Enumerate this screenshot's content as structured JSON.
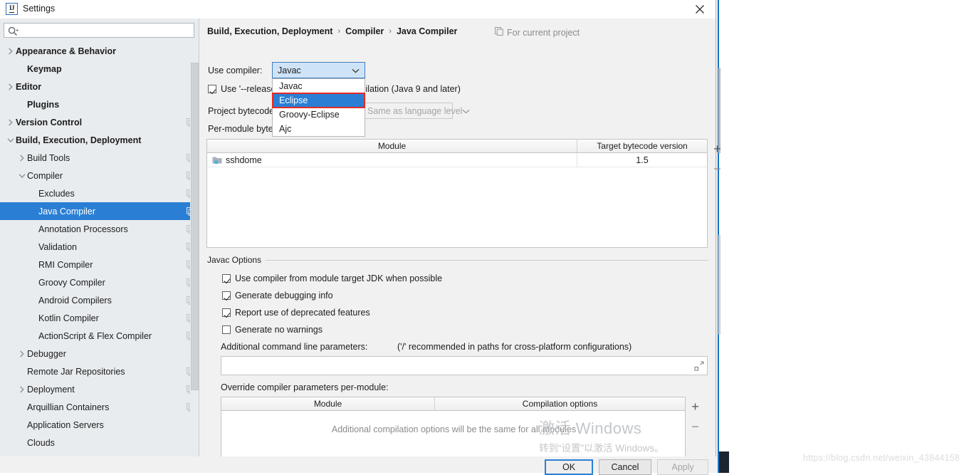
{
  "window": {
    "title": "Settings",
    "app_icon": "intellij-idea-icon",
    "close_icon": "close-icon"
  },
  "search": {
    "value": "",
    "placeholder": "",
    "icon": "search-icon"
  },
  "sidebar": {
    "items": [
      {
        "label": "Appearance & Behavior",
        "indent": 0,
        "twisty": "collapsed",
        "bold": true,
        "copy": false,
        "selected": false
      },
      {
        "label": "Keymap",
        "indent": 1,
        "twisty": "none",
        "bold": true,
        "copy": false,
        "selected": false
      },
      {
        "label": "Editor",
        "indent": 0,
        "twisty": "collapsed",
        "bold": true,
        "copy": false,
        "selected": false
      },
      {
        "label": "Plugins",
        "indent": 1,
        "twisty": "none",
        "bold": true,
        "copy": false,
        "selected": false
      },
      {
        "label": "Version Control",
        "indent": 0,
        "twisty": "collapsed",
        "bold": true,
        "copy": true,
        "selected": false
      },
      {
        "label": "Build, Execution, Deployment",
        "indent": 0,
        "twisty": "expanded",
        "bold": true,
        "copy": false,
        "selected": false
      },
      {
        "label": "Build Tools",
        "indent": 1,
        "twisty": "collapsed",
        "bold": false,
        "copy": true,
        "selected": false
      },
      {
        "label": "Compiler",
        "indent": 1,
        "twisty": "expanded",
        "bold": false,
        "copy": true,
        "selected": false
      },
      {
        "label": "Excludes",
        "indent": 2,
        "twisty": "none",
        "bold": false,
        "copy": true,
        "selected": false
      },
      {
        "label": "Java Compiler",
        "indent": 2,
        "twisty": "none",
        "bold": false,
        "copy": true,
        "selected": true
      },
      {
        "label": "Annotation Processors",
        "indent": 2,
        "twisty": "none",
        "bold": false,
        "copy": true,
        "selected": false
      },
      {
        "label": "Validation",
        "indent": 2,
        "twisty": "none",
        "bold": false,
        "copy": true,
        "selected": false
      },
      {
        "label": "RMI Compiler",
        "indent": 2,
        "twisty": "none",
        "bold": false,
        "copy": true,
        "selected": false
      },
      {
        "label": "Groovy Compiler",
        "indent": 2,
        "twisty": "none",
        "bold": false,
        "copy": true,
        "selected": false
      },
      {
        "label": "Android Compilers",
        "indent": 2,
        "twisty": "none",
        "bold": false,
        "copy": true,
        "selected": false
      },
      {
        "label": "Kotlin Compiler",
        "indent": 2,
        "twisty": "none",
        "bold": false,
        "copy": true,
        "selected": false
      },
      {
        "label": "ActionScript & Flex Compiler",
        "indent": 2,
        "twisty": "none",
        "bold": false,
        "copy": true,
        "selected": false
      },
      {
        "label": "Debugger",
        "indent": 1,
        "twisty": "collapsed",
        "bold": false,
        "copy": false,
        "selected": false
      },
      {
        "label": "Remote Jar Repositories",
        "indent": 1,
        "twisty": "none",
        "bold": false,
        "copy": true,
        "selected": false
      },
      {
        "label": "Deployment",
        "indent": 1,
        "twisty": "collapsed",
        "bold": false,
        "copy": true,
        "selected": false
      },
      {
        "label": "Arquillian Containers",
        "indent": 1,
        "twisty": "none",
        "bold": false,
        "copy": true,
        "selected": false
      },
      {
        "label": "Application Servers",
        "indent": 1,
        "twisty": "none",
        "bold": false,
        "copy": false,
        "selected": false
      },
      {
        "label": "Clouds",
        "indent": 1,
        "twisty": "none",
        "bold": false,
        "copy": false,
        "selected": false
      }
    ]
  },
  "breadcrumb": {
    "parts": [
      "Build, Execution, Deployment",
      "Compiler",
      "Java Compiler"
    ],
    "separator": "›"
  },
  "scope_badge": {
    "label": "For current project",
    "icon": "copy-settings-icon"
  },
  "form": {
    "use_compiler_label": "Use compiler:",
    "use_compiler_value": "Javac",
    "use_compiler_options": [
      "Javac",
      "Eclipse",
      "Groovy-Eclipse",
      "Ajc"
    ],
    "use_compiler_highlighted": "Eclipse",
    "release_option_label": "Use '--release' option for cross-compilation (Java 9 and later)",
    "release_option_checked": true,
    "project_bytecode_label": "Project bytecode version:",
    "project_bytecode_value": "Same as language level",
    "per_module_label": "Per-module bytecode version:"
  },
  "module_table": {
    "columns": [
      "Module",
      "Target bytecode version"
    ],
    "rows": [
      {
        "module": "sshdome",
        "icon": "module-folder-icon",
        "bytecode": "1.5"
      }
    ],
    "add_label": "+",
    "remove_label": "−"
  },
  "javac_options": {
    "group_title": "Javac Options",
    "checkboxes": [
      {
        "label": "Use compiler from module target JDK when possible",
        "checked": true
      },
      {
        "label": "Generate debugging info",
        "checked": true
      },
      {
        "label": "Report use of deprecated features",
        "checked": true
      },
      {
        "label": "Generate no warnings",
        "checked": false
      }
    ],
    "additional_params_label": "Additional command line parameters:",
    "slash_hint": "('/' recommended in paths for cross-platform configurations)",
    "additional_params_value": "",
    "expand_icon": "expand-field-icon"
  },
  "override_table": {
    "title": "Override compiler parameters per-module:",
    "columns": [
      "Module",
      "Compilation options"
    ],
    "empty_message": "Additional compilation options will be the same for all modules",
    "add_label": "+",
    "remove_label": "−"
  },
  "buttons": {
    "ok": "OK",
    "cancel": "Cancel",
    "apply": "Apply"
  },
  "watermarks": {
    "windows_line1": "激活 Windows",
    "windows_line2": "转到“设置”以激活 Windows。",
    "blog_url": "https://blog.csdn.net/weixin_43844158"
  },
  "colors": {
    "accent": "#2a7fd4",
    "highlight_outline": "#e32b26",
    "sidebar_bg": "#e8ecef",
    "panel_bg": "#f1f1f1"
  }
}
